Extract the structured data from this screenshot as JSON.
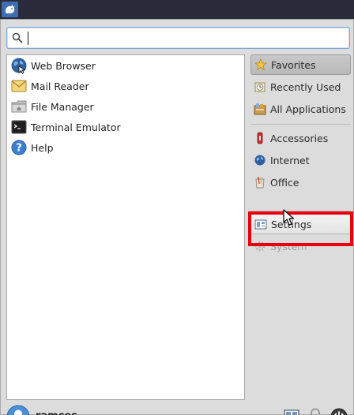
{
  "search": {
    "value": "",
    "placeholder": ""
  },
  "apps": [
    {
      "label": "Web Browser",
      "icon": "globe-icon"
    },
    {
      "label": "Mail Reader",
      "icon": "mail-icon"
    },
    {
      "label": "File Manager",
      "icon": "folder-icon"
    },
    {
      "label": "Terminal Emulator",
      "icon": "terminal-icon"
    },
    {
      "label": "Help",
      "icon": "help-icon"
    }
  ],
  "categories": [
    {
      "label": "Favorites",
      "icon": "star-icon",
      "state": "selected"
    },
    {
      "label": "Recently Used",
      "icon": "clock-icon"
    },
    {
      "label": "All Applications",
      "icon": "all-apps-icon"
    },
    {
      "label": "Accessories",
      "icon": "knife-icon"
    },
    {
      "label": "Internet",
      "icon": "globe-icon"
    },
    {
      "label": "Office",
      "icon": "office-icon"
    },
    {
      "label": "Settings",
      "icon": "settings-icon",
      "state": "hover"
    },
    {
      "label": "System",
      "icon": "gear-icon"
    }
  ],
  "user": {
    "name": "ramces"
  },
  "colors": {
    "highlight": "#e8000d",
    "topbar": "#2b2a3a",
    "accent": "#3c6fb1"
  }
}
